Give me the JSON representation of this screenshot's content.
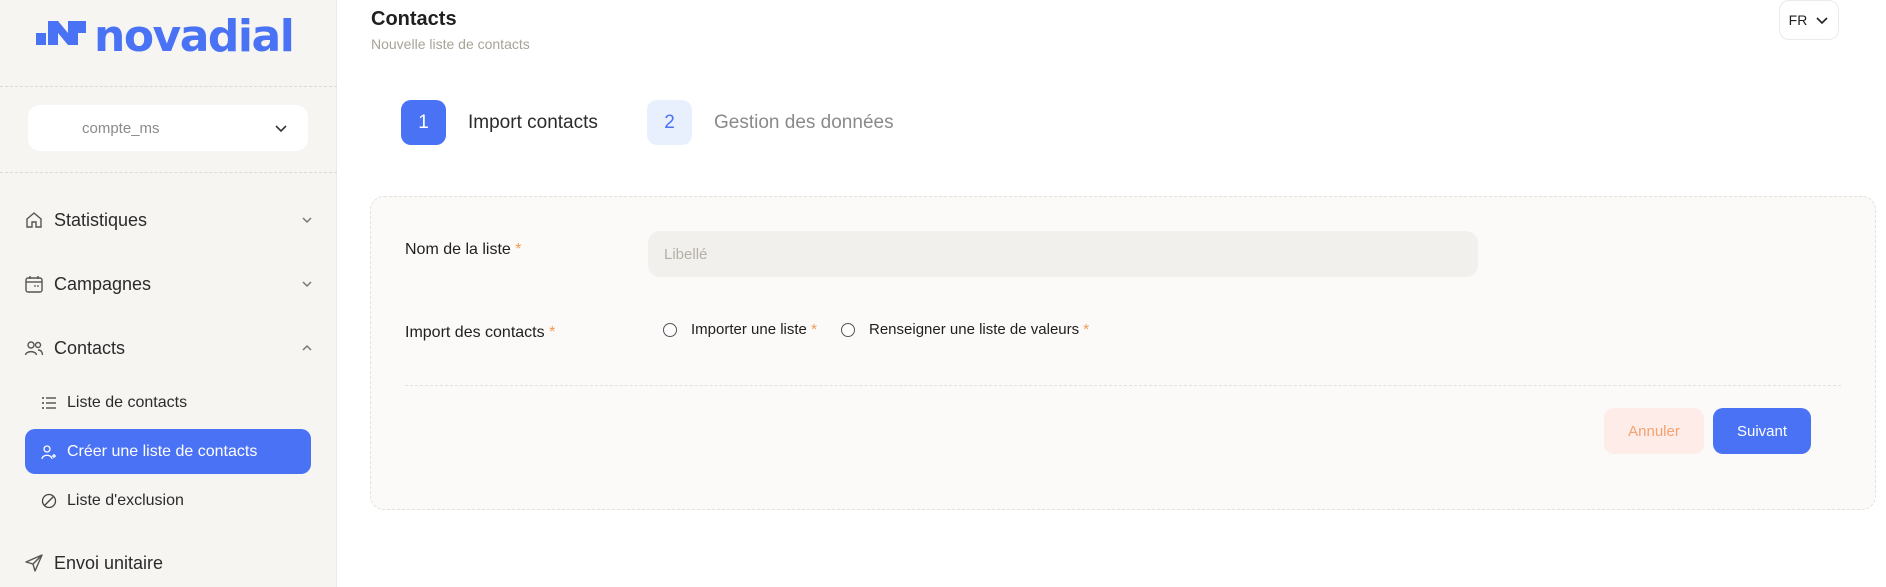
{
  "brand": {
    "name": "novadial",
    "color": "#4a72f5"
  },
  "account": {
    "selected": "compte_ms"
  },
  "nav": {
    "statistiques": "Statistiques",
    "campagnes": "Campagnes",
    "contacts": "Contacts",
    "contacts_sub": {
      "liste": "Liste de contacts",
      "creer": "Créer une liste de contacts",
      "exclusion": "Liste d'exclusion"
    },
    "envoi": "Envoi unitaire"
  },
  "header": {
    "title": "Contacts",
    "subtitle": "Nouvelle liste de contacts",
    "language": "FR"
  },
  "steps": [
    {
      "number": "1",
      "label": "Import contacts",
      "state": "active"
    },
    {
      "number": "2",
      "label": "Gestion des données",
      "state": "inactive"
    }
  ],
  "form": {
    "name_label": "Nom de la liste",
    "name_placeholder": "Libellé",
    "name_value": "",
    "import_label": "Import des contacts",
    "required_mark": "*",
    "option_import": "Importer une liste",
    "option_values": "Renseigner une liste de valeurs",
    "cancel": "Annuler",
    "next": "Suivant"
  },
  "colors": {
    "accent": "#4a72f5",
    "required": "#f39a52",
    "cancel_bg": "#fdece8",
    "cancel_text": "#f3a272",
    "sidebar_bg": "#f6f5f2"
  }
}
